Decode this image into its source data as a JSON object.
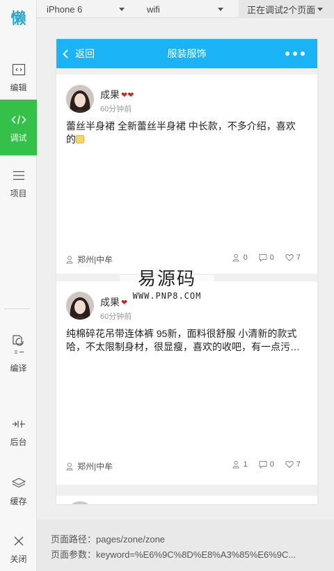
{
  "sidebar": {
    "logo": "懒",
    "items": [
      {
        "label": "编辑",
        "icon": "code-window-icon"
      },
      {
        "label": "调试",
        "icon": "code-brackets-icon"
      },
      {
        "label": "项目",
        "icon": "menu-lines-icon"
      },
      {
        "label": "编译",
        "icon": "compile-icon"
      },
      {
        "label": "后台",
        "icon": "backend-icon"
      },
      {
        "label": "缓存",
        "icon": "layers-icon"
      },
      {
        "label": "关闭",
        "icon": "close-icon"
      }
    ],
    "active_index": 1,
    "active_color": "#35c04a"
  },
  "topbar": {
    "device": "iPhone 6",
    "network": "wifi",
    "debug_status": "正在调试2个页面"
  },
  "phone": {
    "nav": {
      "back_label": "返回",
      "title": "服装服饰",
      "color": "#1ab3f5"
    },
    "posts": [
      {
        "user": "成果",
        "time": "60分钟前",
        "content": "蕾丝半身裙 全新蕾丝半身裙 中长款，不多介绍，喜欢的",
        "location": "郑州|中牟",
        "stats": {
          "views": "0",
          "comments": "0",
          "likes": "7"
        }
      },
      {
        "user": "成果",
        "time": "60分钟前",
        "content": "纯棉碎花吊带连体裤 95新，面料很舒服 小清新的款式哈，不太限制身材，很显瘦，喜欢的收吧，有一点污…",
        "location": "郑州|中牟",
        "stats": {
          "views": "1",
          "comments": "0",
          "likes": "7"
        }
      }
    ]
  },
  "watermark": {
    "title": "易源码",
    "url": "WWW.PNP8.COM"
  },
  "bottom": {
    "path": "页面路径：pages/zone/zone",
    "params": "页面参数：keyword=%E6%9C%8D%E8%A3%85%E6%9C..."
  }
}
